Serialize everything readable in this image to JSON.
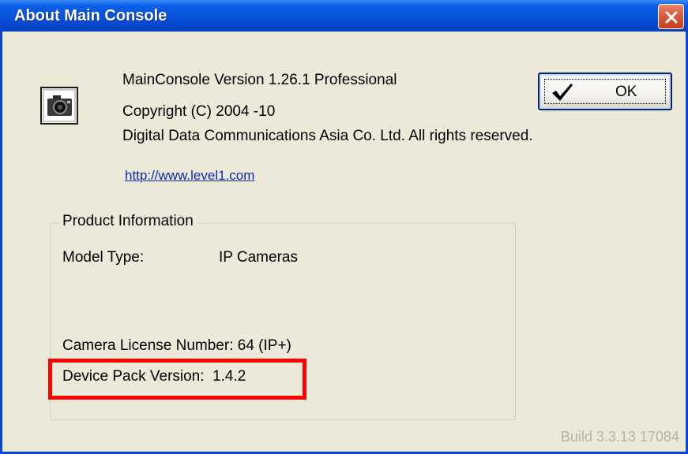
{
  "window": {
    "title": "About Main Console",
    "close_icon": "close-icon"
  },
  "about": {
    "app_icon": "camera-icon",
    "version_line": "MainConsole Version 1.26.1 Professional",
    "copyright_line": "Copyright (C) 2004 -10",
    "rights_line": "Digital Data Communications Asia Co. Ltd. All rights reserved.",
    "link": "http://www.level1.com"
  },
  "ok_button": {
    "label": "OK",
    "icon": "checkmark-icon"
  },
  "product_info": {
    "legend": "Product Information",
    "model_type_label": "Model Type:",
    "model_type_value": "IP Cameras",
    "license_line": "Camera License Number: 64 (IP+)",
    "device_pack_line": "Device Pack Version:  1.4.2"
  },
  "build": "Build 3.3.13 17084",
  "colors": {
    "title_bar": "#0a53da",
    "dialog_bg": "#ece9d8",
    "highlight": "#ff0000",
    "link": "#0c2bb0"
  }
}
